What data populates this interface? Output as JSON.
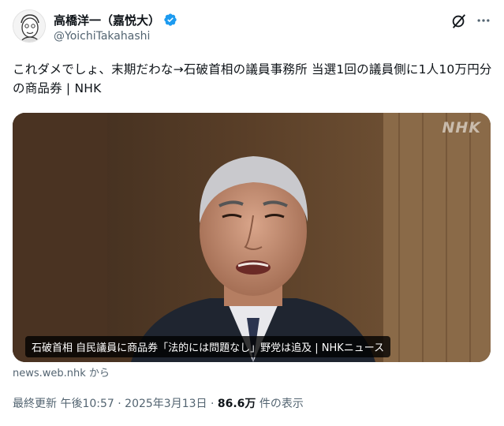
{
  "author": {
    "display_name": "高橋洋一（嘉悦大）",
    "handle": "@YoichiTakahashi"
  },
  "tweet": {
    "text": "これダメでしょ、末期だわな→石破首相の議員事務所 当選1回の議員側に1人10万円分の商品券 | NHK"
  },
  "card": {
    "watermark": "NHK",
    "caption": "石破首相 自民議員に商品券「法的には問題なし」野党は追及 | NHKニュース",
    "source": "news.web.nhk から"
  },
  "meta": {
    "time": "最終更新 午後10:57",
    "separator1": " · ",
    "date": "2025年3月13日",
    "separator2": " · ",
    "views": "86.6万",
    "views_label": " 件の表示"
  },
  "colors": {
    "text_primary": "#0f1419",
    "text_secondary": "#536471",
    "verified_blue": "#1d9bf0"
  },
  "icons": [
    "avatar",
    "verified-badge-icon",
    "grok-icon",
    "more-icon"
  ]
}
